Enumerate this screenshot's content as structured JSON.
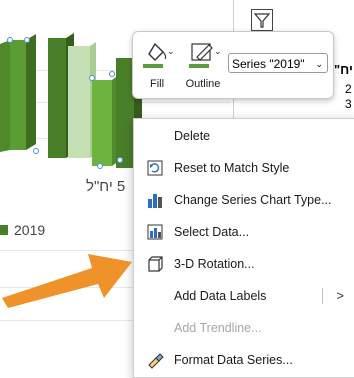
{
  "chart": {
    "category_label": "5 יח\"ל",
    "legend_label": "2019",
    "right_labels": [
      "יח\"",
      "2",
      "3"
    ]
  },
  "mini_toolbar": {
    "fill_label": "Fill",
    "outline_label": "Outline",
    "series_selected": "Series \"2019\"",
    "accent_color": "#5b9b3a"
  },
  "context_menu": {
    "items": [
      {
        "label": "Delete",
        "icon": "none",
        "enabled": true
      },
      {
        "label": "Reset to Match Style",
        "icon": "reset-style-icon",
        "enabled": true
      },
      {
        "label": "Change Series Chart Type...",
        "icon": "chart-type-icon",
        "enabled": true
      },
      {
        "label": "Select Data...",
        "icon": "select-data-icon",
        "enabled": true
      },
      {
        "label": "3-D Rotation...",
        "icon": "rotation-3d-icon",
        "enabled": true
      },
      {
        "label": "Add Data Labels",
        "icon": "none",
        "enabled": true,
        "submenu": true
      },
      {
        "label": "Add Trendline...",
        "icon": "none",
        "enabled": false
      },
      {
        "label": "Format Data Series...",
        "icon": "format-series-icon",
        "enabled": true
      }
    ]
  },
  "annotation_color": "#f0922a"
}
